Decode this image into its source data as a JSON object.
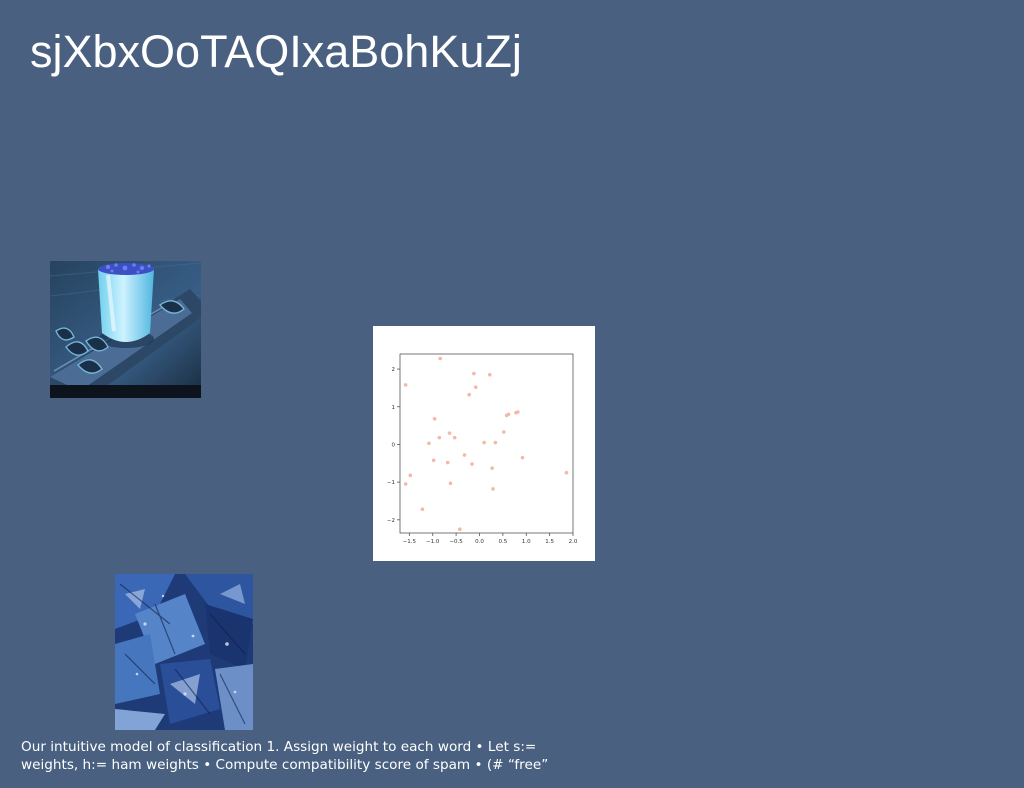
{
  "slide": {
    "title": "sjXbxOoTAQIxaBohKuZj",
    "caption": "Our intuitive model of classification 1. Assign weight to each word • Let s:= weights, h:= ham weights • Compute compatibility score of spam • (# “free”"
  },
  "colors": {
    "background": "#4a6080",
    "title_text": "#ffffff",
    "caption_text": "#ffffff",
    "scatter_point": "#f4b8a6"
  },
  "images": {
    "drink": "photo-of-blue-drink-on-tray",
    "leaves": "photo-of-blue-autumn-leaves"
  },
  "chart_data": {
    "type": "scatter",
    "title": "",
    "xlabel": "",
    "ylabel": "",
    "xlim": [
      -1.7,
      2.0
    ],
    "ylim": [
      -2.35,
      2.4
    ],
    "x_ticks": [
      -1.5,
      -1.0,
      -0.5,
      0.0,
      0.5,
      1.0,
      1.5,
      2.0
    ],
    "x_tick_labels": [
      "−1.5",
      "−1.0",
      "−0.5",
      "0.0",
      "0.5",
      "1.0",
      "1.5",
      "2.0"
    ],
    "y_ticks": [
      2,
      1,
      0,
      -1,
      -2
    ],
    "y_tick_labels": [
      "2",
      "1",
      "0",
      "−1",
      "−2"
    ],
    "grid": false,
    "points": [
      {
        "x": -1.58,
        "y": 1.58
      },
      {
        "x": -1.58,
        "y": -1.05
      },
      {
        "x": -1.48,
        "y": -0.82
      },
      {
        "x": -1.22,
        "y": -1.72
      },
      {
        "x": -1.08,
        "y": 0.03
      },
      {
        "x": -0.98,
        "y": -0.42
      },
      {
        "x": -0.96,
        "y": 0.68
      },
      {
        "x": -0.86,
        "y": 0.18
      },
      {
        "x": -0.84,
        "y": 2.28
      },
      {
        "x": -0.68,
        "y": -0.48
      },
      {
        "x": -0.64,
        "y": 0.3
      },
      {
        "x": -0.62,
        "y": -1.03
      },
      {
        "x": -0.53,
        "y": 0.18
      },
      {
        "x": -0.42,
        "y": -2.25
      },
      {
        "x": -0.32,
        "y": -0.28
      },
      {
        "x": -0.22,
        "y": 1.32
      },
      {
        "x": -0.16,
        "y": -0.52
      },
      {
        "x": -0.12,
        "y": 1.88
      },
      {
        "x": -0.08,
        "y": 1.52
      },
      {
        "x": 0.1,
        "y": 0.05
      },
      {
        "x": 0.22,
        "y": 1.85
      },
      {
        "x": 0.27,
        "y": -0.63
      },
      {
        "x": 0.29,
        "y": -1.18
      },
      {
        "x": 0.34,
        "y": 0.05
      },
      {
        "x": 0.52,
        "y": 0.33
      },
      {
        "x": 0.58,
        "y": 0.77
      },
      {
        "x": 0.62,
        "y": 0.8
      },
      {
        "x": 0.78,
        "y": 0.84
      },
      {
        "x": 0.82,
        "y": 0.86
      },
      {
        "x": 0.92,
        "y": -0.35
      },
      {
        "x": 1.86,
        "y": -0.75
      }
    ]
  }
}
